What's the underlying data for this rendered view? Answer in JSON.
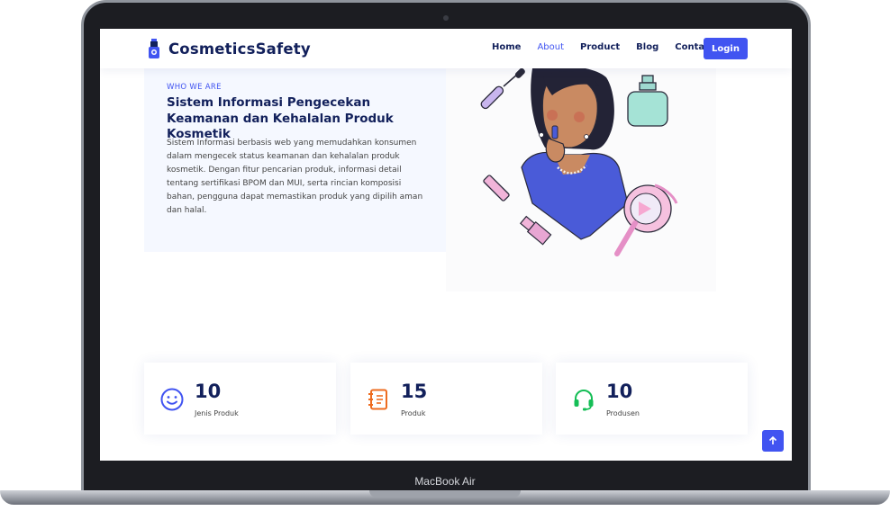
{
  "device": {
    "label": "MacBook Air"
  },
  "navbar": {
    "brand": "CosmeticsSafety",
    "links": [
      "Home",
      "About",
      "Product",
      "Blog",
      "Contact"
    ],
    "active": "About",
    "login_label": "Login"
  },
  "about": {
    "eyebrow": "WHO WE ARE",
    "title": "Sistem Informasi Pengecekan Keamanan dan Kehalalan Produk Kosmetik",
    "body": "Sistem Informasi berbasis web yang memudahkan konsumen dalam mengecek status keamanan dan kehalalan produk kosmetik. Dengan fitur pencarian produk, informasi detail tentang sertifikasi BPOM dan MUI, serta rincian komposisi bahan, pengguna dapat memastikan produk yang dipilih aman dan halal."
  },
  "stats": [
    {
      "value": "10",
      "label": "Jenis Produk",
      "icon": "smile-icon",
      "color": "#4154f1"
    },
    {
      "value": "15",
      "label": "Produk",
      "icon": "journal-icon",
      "color": "#ee6c20"
    },
    {
      "value": "10",
      "label": "Produsen",
      "icon": "headset-icon",
      "color": "#15be56"
    }
  ],
  "colors": {
    "accent": "#4154f1",
    "heading": "#12205b",
    "about_bg": "#f5f8ff"
  }
}
